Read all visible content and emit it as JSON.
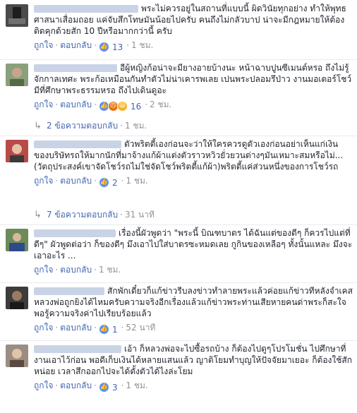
{
  "comments": [
    {
      "text": "พระไม่ควรอยู่ในสถานที่แบบนี้ ผิดวินัยทุกอย่าง ทำให้พุทธศาสนาเสื่อมถอย แค่จับสึกโทษมันน้อยไปครับ คนถึงไม่กลัวบาป น่าจะมีกฎหมายให้ต้องติดคุกด้วยสัก 10 ปีหรือมากกว่านี้ ครับ",
      "like": "ถูกใจ",
      "reply": "ตอบกลับ",
      "reactions": "13",
      "time": "1 ชม.",
      "reaction_icons": [
        "like-icon"
      ]
    },
    {
      "text": "อีผู้หญิงก้อน่าจะมียางอายบ้างนะ หน้าฉาบปูนซีเมนต์หรอ ถึงไม่รู้จักกาลเทศะ พระก้อเหมือนกันทำตัวไม่น่าเคารพเลย เปนพระปลอมรึป่าว งานมอเตอร์โชว์มีที่ศึกษาพระธรรมหรอ ถึงไปเดินดูอะ",
      "like": "ถูกใจ",
      "reply": "ตอบกลับ",
      "reactions": "16",
      "time": "2 ชม.",
      "reaction_icons": [
        "like-icon",
        "angry-icon",
        "haha-icon"
      ]
    },
    {
      "text": "ตัวพริตตี้เองก่อนจะว่าให้ใครควรดูตัวเองก่อนอย่าเห็นแก่เงินของบริษัทรถให้มากนักที่มาจ้างแก้ผ้าแต่งตัวราวหวิวยั่วยวนต่างๆมันเหมาะสมหรือไม่...(วัตถุประสงค์เขาจัดโชว์รถไม่ใช่จัดโชว์พริตตี้แก้ผ้า)พริตตี้แค่ส่วนหนึ่งของการโชว์รถ",
      "like": "ถูกใจ",
      "reply": "ตอบกลับ",
      "reactions": "2",
      "time": "1 ชม.",
      "reaction_icons": [
        "like-icon"
      ]
    },
    {
      "text": "เรื่องนี้ผัวพูดว่า \"พระนี้ บิณฑบาตร ได้ฉันแต่ของดีๆ ก็ควรไปแต่ที่ดีๆ\" ผัวพูดต่อว่า ก็ของดีๆ มึงเอาไปใส่บาตรซะหมดเลย กูกินของเหลือๆ ทั้งนั้นแหละ มึงจะเอาอะไร ...",
      "like": "ถูกใจ",
      "reply": "ตอบกลับ",
      "reactions": "",
      "time": "1 ชม.",
      "reaction_icons": []
    },
    {
      "text": "สักพักเดี๋ยวก็แก้ข่าวรีบลงข่าวทำลายพระแล้วค่อยแก้ข่าวทีหลังจำเคสหลวงพ่อถูกยิงได้ไหมครับความจริงอีกเรื่องแล้วแก้ข่าวพระท่านเสียหายคนด่าพระก็สะใจพอรู้ความจริงค่าไปเรียบร้อยแล้ว",
      "like": "ถูกใจ",
      "reply": "ตอบกลับ",
      "reactions": "1",
      "time": "52 นาที",
      "reaction_icons": [
        "like-icon"
      ]
    },
    {
      "text": "เอ้า ก็หลวงพ่อจะไปซื้อรถบ้าง ก็ต้องไปดูๆโปรโมชั่น ไปศึกษาที่งานเอาไว้ก่อน พอดีเก็บเงินได้หลายแสนแล้ว ญาติโยมทำบุญให้ปัจจัยมาเยอะ ก็ต้องใช้สักหน่อย เวลาสึกออกไปจะได้ตั้งตัวได้ไงล่ะโยม",
      "like": "ถูกใจ",
      "reply": "ตอบกลับ",
      "reactions": "3",
      "time": "1 ชม.",
      "reaction_icons": [
        "like-icon"
      ]
    }
  ],
  "reply_threads": [
    {
      "label": "2 ข้อความตอบกลับ",
      "time": "1 ชม."
    },
    {
      "label": "7 ข้อความตอบกลับ",
      "time": "31 นาที"
    }
  ],
  "colors": {
    "link": "#4267b2",
    "meta": "#90949c",
    "text": "#1d2129",
    "like_blue": "#5890ff",
    "angry_orange": "#e9710f",
    "haha_yellow": "#f7b125"
  }
}
